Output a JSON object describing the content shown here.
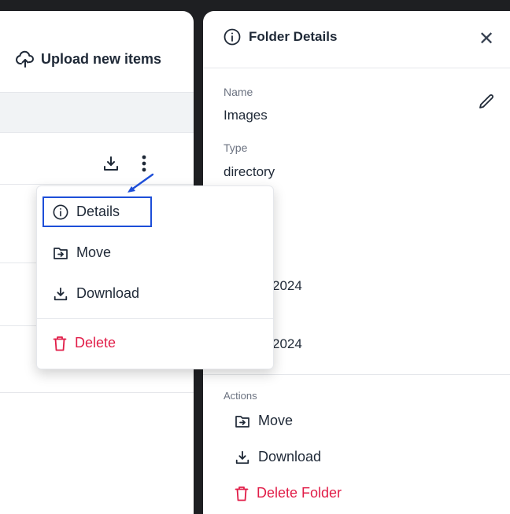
{
  "left_panel": {
    "upload_label": "Upload new items"
  },
  "context_menu": {
    "items": [
      {
        "label": "Details",
        "icon": "info-icon"
      },
      {
        "label": "Move",
        "icon": "folder-move-icon"
      },
      {
        "label": "Download",
        "icon": "download-icon"
      },
      {
        "label": "Delete",
        "icon": "trash-icon"
      }
    ]
  },
  "folder_details": {
    "title": "Folder Details",
    "name_label": "Name",
    "name_value": "Images",
    "type_label": "Type",
    "type_value": "directory",
    "created_partial": "2024",
    "modified_partial": "2024",
    "actions_label": "Actions",
    "actions": [
      {
        "label": "Move",
        "icon": "folder-move-icon"
      },
      {
        "label": "Download",
        "icon": "download-icon"
      },
      {
        "label": "Delete Folder",
        "icon": "trash-icon"
      }
    ]
  },
  "colors": {
    "danger": "#e11d48",
    "highlight": "#1d4ed8",
    "backdrop": "#1e1f22"
  }
}
